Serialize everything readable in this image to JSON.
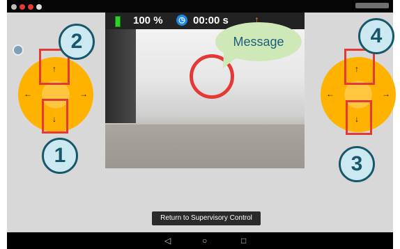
{
  "infobar": {
    "battery_percent": "100 %",
    "timer": "00:00 s"
  },
  "message": "Message",
  "badges": [
    "1",
    "2",
    "3",
    "4"
  ],
  "left_dpad": {
    "up": "↑",
    "down": "↓",
    "left": "←",
    "right": "→"
  },
  "right_dpad": {
    "up": "↑",
    "down": "↓",
    "left": "←",
    "right": "→"
  },
  "return_button": "Return to Supervisory Control",
  "nav": {
    "back": "◁",
    "home": "○",
    "recents": "□"
  },
  "icons": [
    "battery-icon",
    "timer-icon",
    "alert-arrow-icon",
    "app-settings-icon"
  ],
  "colors": {
    "dpad": "#ffb300",
    "highlight": "#e53935",
    "badge_border": "#17576b"
  }
}
